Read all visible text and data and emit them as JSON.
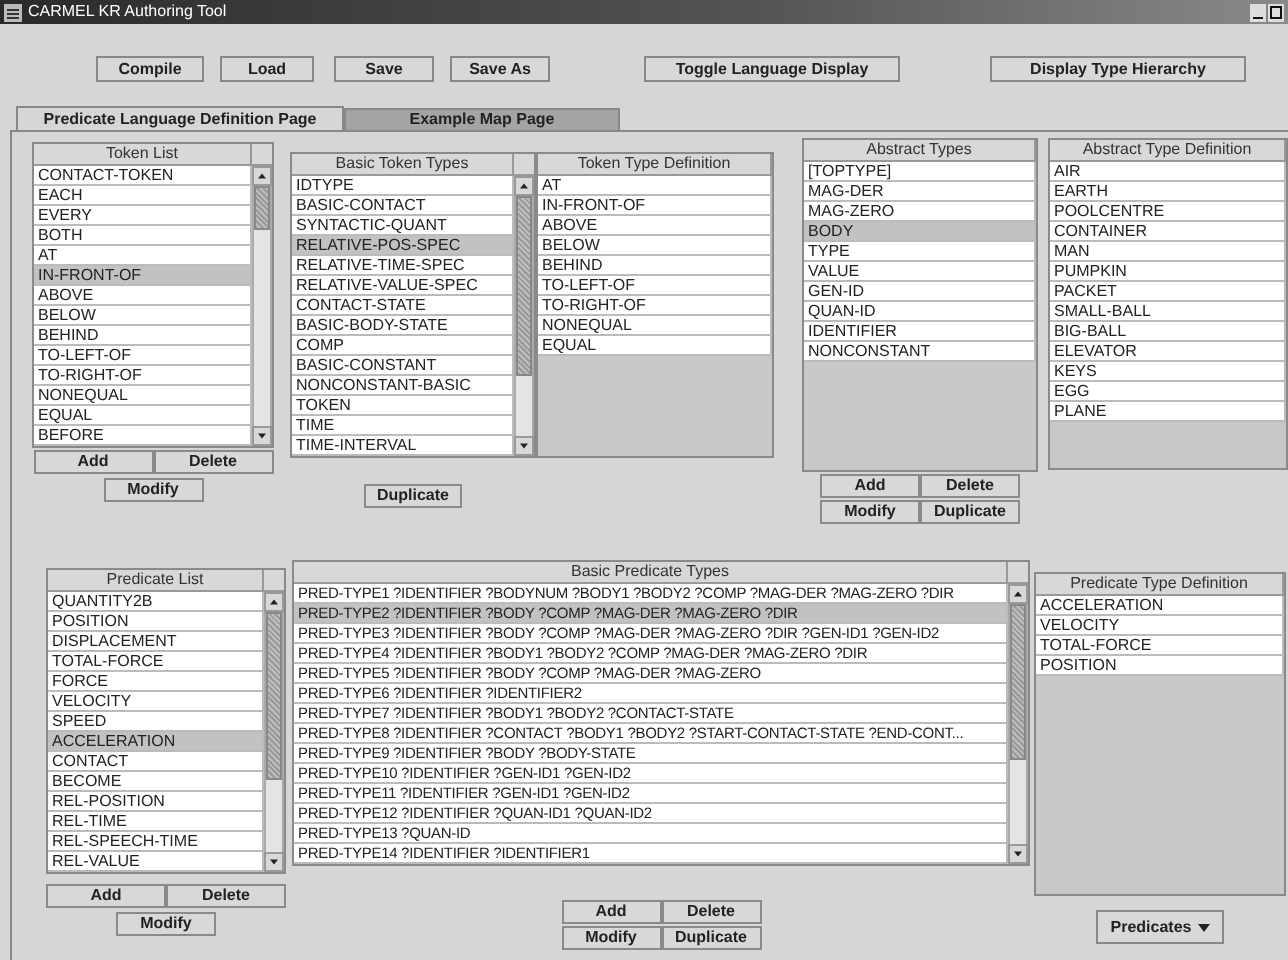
{
  "window": {
    "title": "CARMEL KR Authoring Tool"
  },
  "toolbar": [
    "Compile",
    "Load",
    "Save",
    "Save As",
    "Toggle Language Display",
    "Display Type Hierarchy"
  ],
  "tabs": [
    {
      "label": "Predicate Language Definition Page",
      "selected": true
    },
    {
      "label": "Example Map Page",
      "selected": false
    }
  ],
  "token_list": {
    "title": "Token List",
    "items": [
      {
        "label": "CONTACT-TOKEN",
        "selected": false
      },
      {
        "label": "EACH",
        "selected": false
      },
      {
        "label": "EVERY",
        "selected": false
      },
      {
        "label": "BOTH",
        "selected": false
      },
      {
        "label": "AT",
        "selected": false
      },
      {
        "label": "IN-FRONT-OF",
        "selected": true
      },
      {
        "label": "ABOVE",
        "selected": false
      },
      {
        "label": "BELOW",
        "selected": false
      },
      {
        "label": "BEHIND",
        "selected": false
      },
      {
        "label": "TO-LEFT-OF",
        "selected": false
      },
      {
        "label": "TO-RIGHT-OF",
        "selected": false
      },
      {
        "label": "NONEQUAL",
        "selected": false
      },
      {
        "label": "EQUAL",
        "selected": false
      },
      {
        "label": "BEFORE",
        "selected": false
      }
    ],
    "buttons": [
      "Add",
      "Delete",
      "Modify"
    ]
  },
  "basic_token_types": {
    "title": "Basic Token Types",
    "items": [
      {
        "label": "IDTYPE",
        "selected": false
      },
      {
        "label": "BASIC-CONTACT",
        "selected": false
      },
      {
        "label": "SYNTACTIC-QUANT",
        "selected": false
      },
      {
        "label": "RELATIVE-POS-SPEC",
        "selected": true
      },
      {
        "label": "RELATIVE-TIME-SPEC",
        "selected": false
      },
      {
        "label": "RELATIVE-VALUE-SPEC",
        "selected": false
      },
      {
        "label": "CONTACT-STATE",
        "selected": false
      },
      {
        "label": "BASIC-BODY-STATE",
        "selected": false
      },
      {
        "label": "COMP",
        "selected": false
      },
      {
        "label": "BASIC-CONSTANT",
        "selected": false
      },
      {
        "label": "NONCONSTANT-BASIC",
        "selected": false
      },
      {
        "label": "TOKEN",
        "selected": false
      },
      {
        "label": "TIME",
        "selected": false
      },
      {
        "label": "TIME-INTERVAL",
        "selected": false
      }
    ],
    "buttons": [
      "Duplicate"
    ]
  },
  "token_type_definition": {
    "title": "Token Type Definition",
    "items": [
      "AT",
      "IN-FRONT-OF",
      "ABOVE",
      "BELOW",
      "BEHIND",
      "TO-LEFT-OF",
      "TO-RIGHT-OF",
      "NONEQUAL",
      "EQUAL"
    ]
  },
  "abstract_types": {
    "title": "Abstract Types",
    "items": [
      {
        "label": "[TOPTYPE]",
        "selected": false
      },
      {
        "label": "MAG-DER",
        "selected": false
      },
      {
        "label": "MAG-ZERO",
        "selected": false
      },
      {
        "label": "BODY",
        "selected": true
      },
      {
        "label": "TYPE",
        "selected": false
      },
      {
        "label": "VALUE",
        "selected": false
      },
      {
        "label": "GEN-ID",
        "selected": false
      },
      {
        "label": "QUAN-ID",
        "selected": false
      },
      {
        "label": "IDENTIFIER",
        "selected": false
      },
      {
        "label": "NONCONSTANT",
        "selected": false
      }
    ],
    "buttons": [
      "Add",
      "Delete",
      "Modify",
      "Duplicate"
    ]
  },
  "abstract_type_definition": {
    "title": "Abstract Type Definition",
    "items": [
      "AIR",
      "EARTH",
      "POOLCENTRE",
      "CONTAINER",
      "MAN",
      "PUMPKIN",
      "PACKET",
      "SMALL-BALL",
      "BIG-BALL",
      "ELEVATOR",
      "KEYS",
      "EGG",
      "PLANE"
    ]
  },
  "predicate_list": {
    "title": "Predicate List",
    "items": [
      {
        "label": "QUANTITY2B",
        "selected": false
      },
      {
        "label": "POSITION",
        "selected": false
      },
      {
        "label": "DISPLACEMENT",
        "selected": false
      },
      {
        "label": "TOTAL-FORCE",
        "selected": false
      },
      {
        "label": "FORCE",
        "selected": false
      },
      {
        "label": "VELOCITY",
        "selected": false
      },
      {
        "label": "SPEED",
        "selected": false
      },
      {
        "label": "ACCELERATION",
        "selected": true
      },
      {
        "label": "CONTACT",
        "selected": false
      },
      {
        "label": "BECOME",
        "selected": false
      },
      {
        "label": "REL-POSITION",
        "selected": false
      },
      {
        "label": "REL-TIME",
        "selected": false
      },
      {
        "label": "REL-SPEECH-TIME",
        "selected": false
      },
      {
        "label": "REL-VALUE",
        "selected": false
      }
    ],
    "buttons": [
      "Add",
      "Delete",
      "Modify"
    ]
  },
  "basic_predicate_types": {
    "title": "Basic Predicate Types",
    "items": [
      {
        "label": "PRED-TYPE1 ?IDENTIFIER ?BODYNUM ?BODY1 ?BODY2 ?COMP ?MAG-DER ?MAG-ZERO ?DIR",
        "selected": false
      },
      {
        "label": "PRED-TYPE2 ?IDENTIFIER ?BODY ?COMP ?MAG-DER ?MAG-ZERO ?DIR",
        "selected": true
      },
      {
        "label": "PRED-TYPE3 ?IDENTIFIER ?BODY ?COMP ?MAG-DER ?MAG-ZERO ?DIR ?GEN-ID1 ?GEN-ID2",
        "selected": false
      },
      {
        "label": "PRED-TYPE4 ?IDENTIFIER ?BODY1 ?BODY2 ?COMP ?MAG-DER ?MAG-ZERO ?DIR",
        "selected": false
      },
      {
        "label": "PRED-TYPE5 ?IDENTIFIER ?BODY ?COMP ?MAG-DER ?MAG-ZERO",
        "selected": false
      },
      {
        "label": "PRED-TYPE6 ?IDENTIFIER ?IDENTIFIER2",
        "selected": false
      },
      {
        "label": "PRED-TYPE7 ?IDENTIFIER ?BODY1 ?BODY2 ?CONTACT-STATE",
        "selected": false
      },
      {
        "label": "PRED-TYPE8 ?IDENTIFIER ?CONTACT ?BODY1 ?BODY2 ?START-CONTACT-STATE ?END-CONT...",
        "selected": false
      },
      {
        "label": "PRED-TYPE9 ?IDENTIFIER ?BODY ?BODY-STATE",
        "selected": false
      },
      {
        "label": "PRED-TYPE10 ?IDENTIFIER ?GEN-ID1 ?GEN-ID2",
        "selected": false
      },
      {
        "label": "PRED-TYPE11 ?IDENTIFIER ?GEN-ID1 ?GEN-ID2",
        "selected": false
      },
      {
        "label": "PRED-TYPE12 ?IDENTIFIER ?QUAN-ID1 ?QUAN-ID2",
        "selected": false
      },
      {
        "label": "PRED-TYPE13 ?QUAN-ID",
        "selected": false
      },
      {
        "label": "PRED-TYPE14 ?IDENTIFIER ?IDENTIFIER1",
        "selected": false
      }
    ],
    "buttons": [
      "Add",
      "Delete",
      "Modify",
      "Duplicate"
    ]
  },
  "predicate_type_definition": {
    "title": "Predicate Type Definition",
    "items": [
      "ACCELERATION",
      "VELOCITY",
      "TOTAL-FORCE",
      "POSITION"
    ]
  },
  "predicates_menu": {
    "label": "Predicates"
  }
}
